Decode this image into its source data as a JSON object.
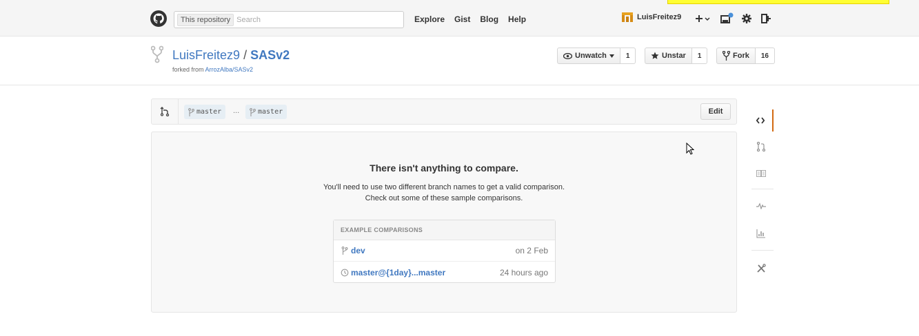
{
  "header": {
    "search": {
      "scope": "This repository",
      "placeholder": "Search"
    },
    "nav": [
      "Explore",
      "Gist",
      "Blog",
      "Help"
    ],
    "user": {
      "name": "LuisFreitez9"
    },
    "icons": {
      "logo": "github-octocat-icon",
      "create": "plus-icon",
      "notifications": "notifications-icon",
      "settings": "gear-icon",
      "signout": "sign-out-icon"
    }
  },
  "repo": {
    "owner": "LuisFreitez9",
    "separator": "/",
    "name": "SASv2",
    "forked_prefix": "forked from",
    "forked_source": "ArrozAlba/SASv2",
    "actions": {
      "watch": {
        "label": "Unwatch",
        "count": "1"
      },
      "star": {
        "label": "Unstar",
        "count": "1"
      },
      "fork": {
        "label": "Fork",
        "count": "16"
      }
    }
  },
  "compare": {
    "base": "master",
    "dots": "...",
    "head": "master",
    "edit_label": "Edit"
  },
  "blankslate": {
    "title": "There isn't anything to compare.",
    "line1": "You'll need to use two different branch names to get a valid comparison.",
    "line2": "Check out some of these sample comparisons.",
    "examples_heading": "EXAMPLE COMPARISONS",
    "examples": [
      {
        "icon": "branch-icon",
        "name": "dev",
        "time": "on 2 Feb"
      },
      {
        "icon": "history-icon",
        "name": "master@{1day}...master",
        "time": "24 hours ago"
      }
    ]
  },
  "sidebar": {
    "items": [
      "code-icon",
      "pull-request-icon",
      "wiki-icon",
      "pulse-icon",
      "graphs-icon",
      "settings-tools-icon"
    ]
  },
  "colors": {
    "link": "#4078c0",
    "active_tab": "#d26911"
  }
}
